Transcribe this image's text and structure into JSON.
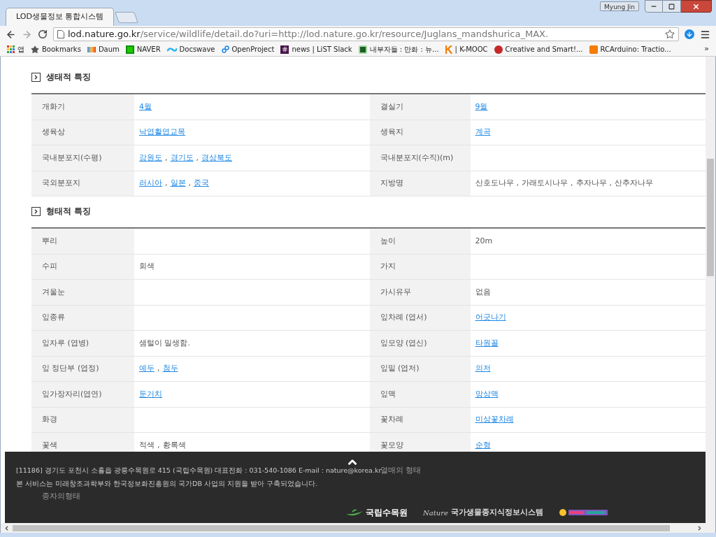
{
  "window": {
    "user": "Myung Jin"
  },
  "tabs": [
    {
      "title": "LOD생물정보 통합시스템",
      "selected": true
    }
  ],
  "address_bar": {
    "host": "lod.nature.go.kr",
    "path": "/service/wildlife/detail.do?uri=http://lod.nature.go.kr/resource/Juglans_mandshurica_MAX."
  },
  "bookmarks": [
    {
      "label": "앱",
      "kind": "apps"
    },
    {
      "label": "Bookmarks",
      "kind": "star"
    },
    {
      "label": "Daum",
      "kind": "daum"
    },
    {
      "label": "NAVER",
      "kind": "naver"
    },
    {
      "label": "Docswave",
      "kind": "wave"
    },
    {
      "label": "OpenProject",
      "kind": "link"
    },
    {
      "label": "news | LiST Slack",
      "kind": "slack"
    },
    {
      "label": "내부자들 : 만화 : 뉴...",
      "kind": "webtoon"
    },
    {
      "label": "| K-MOOC",
      "kind": "kmooc"
    },
    {
      "label": "Creative and Smart!...",
      "kind": "circle"
    },
    {
      "label": "RCArduino: Tractio...",
      "kind": "blogger"
    }
  ],
  "bookmarks_overflow": "»",
  "value_separator": ",",
  "sections": [
    {
      "title": "생태적 특징",
      "rows": [
        [
          {
            "label": "개화기",
            "values": [
              {
                "text": "4월",
                "kind": "link"
              }
            ]
          },
          {
            "label": "결실기",
            "values": [
              {
                "text": "9월",
                "kind": "link"
              }
            ]
          }
        ],
        [
          {
            "label": "생육상",
            "values": [
              {
                "text": "낙엽활엽교목",
                "kind": "link"
              }
            ]
          },
          {
            "label": "생육지",
            "values": [
              {
                "text": "계곡",
                "kind": "link"
              }
            ]
          }
        ],
        [
          {
            "label": "국내분포지(수평)",
            "values": [
              {
                "text": "강원도",
                "kind": "link"
              },
              {
                "text": "경기도",
                "kind": "link"
              },
              {
                "text": "경상북도",
                "kind": "link"
              }
            ]
          },
          {
            "label": "국내분포지(수직)(m)"
          }
        ],
        [
          {
            "label": "국외분포지",
            "values": [
              {
                "text": "러시아",
                "kind": "link"
              },
              {
                "text": "일본",
                "kind": "link"
              },
              {
                "text": "중국",
                "kind": "link"
              }
            ]
          },
          {
            "label": "지방명",
            "values": [
              {
                "text": "산호도나무",
                "kind": "plain"
              },
              {
                "text": "가래토시나무",
                "kind": "plain"
              },
              {
                "text": "추자나무",
                "kind": "plain"
              },
              {
                "text": "산추자나무",
                "kind": "plain"
              }
            ]
          }
        ]
      ]
    },
    {
      "title": "형태적 특징",
      "rows": [
        [
          {
            "label": "뿌리"
          },
          {
            "label": "높이",
            "values": [
              {
                "text": "20m",
                "kind": "plain"
              }
            ]
          }
        ],
        [
          {
            "label": "수피",
            "values": [
              {
                "text": "회색",
                "kind": "plain"
              }
            ]
          },
          {
            "label": "가지"
          }
        ],
        [
          {
            "label": "겨울눈"
          },
          {
            "label": "가시유무",
            "values": [
              {
                "text": "없음",
                "kind": "plain"
              }
            ]
          }
        ],
        [
          {
            "label": "잎종류"
          },
          {
            "label": "잎차례 (엽서)",
            "values": [
              {
                "text": "어긋나기",
                "kind": "link"
              }
            ]
          }
        ],
        [
          {
            "label": "잎자루 (엽병)",
            "values": [
              {
                "text": "샘털이 밀생함.",
                "kind": "plain"
              }
            ]
          },
          {
            "label": "잎모양 (엽신)",
            "values": [
              {
                "text": "타원꼴",
                "kind": "link"
              }
            ]
          }
        ],
        [
          {
            "label": "잎 정단부 (엽정)",
            "values": [
              {
                "text": "예두",
                "kind": "link"
              },
              {
                "text": "첨두",
                "kind": "link"
              }
            ]
          },
          {
            "label": "잎밑 (엽저)",
            "values": [
              {
                "text": "의저",
                "kind": "link"
              }
            ]
          }
        ],
        [
          {
            "label": "잎가장자리(엽연)",
            "values": [
              {
                "text": "둔거치",
                "kind": "link"
              }
            ]
          },
          {
            "label": "잎맥",
            "values": [
              {
                "text": "망상맥",
                "kind": "link"
              }
            ]
          }
        ],
        [
          {
            "label": "화경"
          },
          {
            "label": "꽃차례",
            "values": [
              {
                "text": "미상꽃차례",
                "kind": "link"
              }
            ]
          }
        ],
        [
          {
            "label": "꽃색",
            "values": [
              {
                "text": "적색",
                "kind": "plain"
              },
              {
                "text": "황록색",
                "kind": "plain"
              }
            ]
          },
          {
            "label": "꽃모양",
            "values": [
              {
                "text": "순형",
                "kind": "link"
              }
            ]
          }
        ],
        [
          {},
          {
            "label": "열매의 형태"
          }
        ],
        [
          {
            "label": "종자의형태"
          },
          {}
        ]
      ]
    }
  ],
  "footer": {
    "lines": [
      "[11186] 경기도 포천시 소흘읍 광릉수목원로 415 (국립수목원) 대표전화 : 031-540-1086 E-mail : nature@korea.kr",
      "본 서비스는 미래창조과학부와 한국정보화진흥원의 국가DB 사업의 지원을 받아 구축되었습니다."
    ],
    "logos": [
      {
        "text": "국립수목원",
        "kind": "arboretum"
      },
      {
        "prefix": "Nature",
        "text": "국가생물종지식정보시스템",
        "kind": "nature"
      },
      {
        "kind": "museum"
      }
    ]
  }
}
